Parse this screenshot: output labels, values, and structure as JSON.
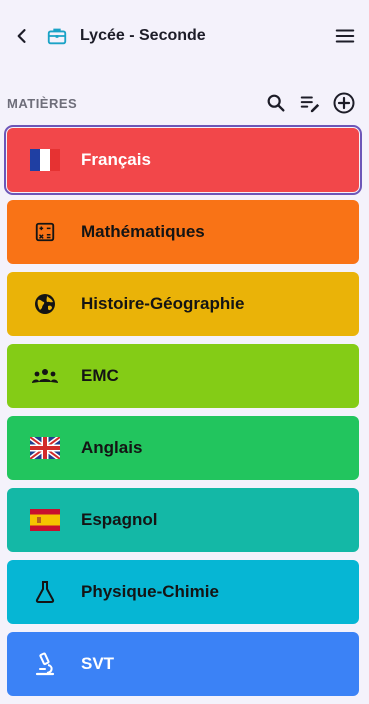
{
  "header": {
    "title": "Lycée - Seconde",
    "back_icon": "chevron-left-icon",
    "app_icon": "briefcase-icon",
    "menu_icon": "hamburger-menu-icon"
  },
  "section": {
    "label": "MATIÈRES",
    "tools": [
      "search-icon",
      "edit-list-icon",
      "add-circle-icon"
    ]
  },
  "subjects": [
    {
      "label": "Français",
      "icon": "france-flag-icon",
      "color": "#f2474a",
      "selected": true
    },
    {
      "label": "Mathématiques",
      "icon": "calculator-icon",
      "color": "#f97316",
      "selected": false
    },
    {
      "label": "Histoire-Géographie",
      "icon": "globe-icon",
      "color": "#eab308",
      "selected": false
    },
    {
      "label": "EMC",
      "icon": "group-icon",
      "color": "#84cc16",
      "selected": false
    },
    {
      "label": "Anglais",
      "icon": "uk-flag-icon",
      "color": "#22c55e",
      "selected": false
    },
    {
      "label": "Espagnol",
      "icon": "spain-flag-icon",
      "color": "#14b8a6",
      "selected": false
    },
    {
      "label": "Physique-Chimie",
      "icon": "flask-icon",
      "color": "#06b6d4",
      "selected": false
    },
    {
      "label": "SVT",
      "icon": "microscope-icon",
      "color": "#3b82f6",
      "selected": false
    }
  ]
}
